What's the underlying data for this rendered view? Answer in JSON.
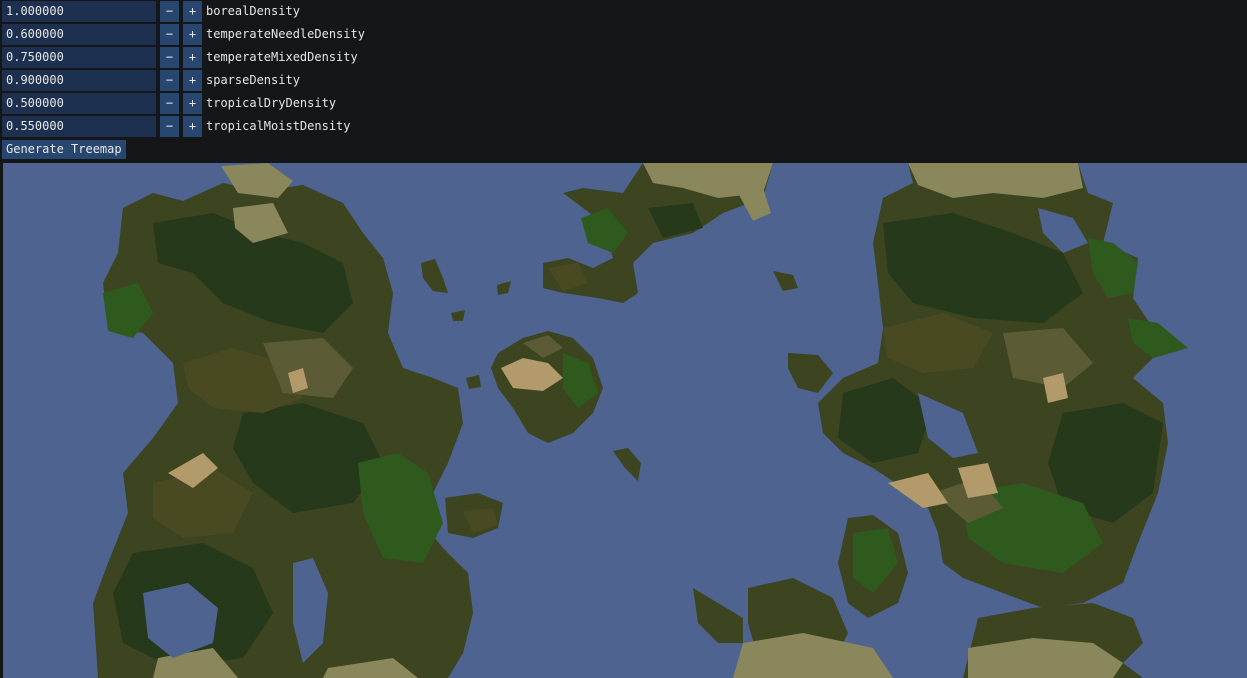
{
  "params": [
    {
      "value": "1.000000",
      "label": "borealDensity"
    },
    {
      "value": "0.600000",
      "label": "temperateNeedleDensity"
    },
    {
      "value": "0.750000",
      "label": "temperateMixedDensity"
    },
    {
      "value": "0.900000",
      "label": "sparseDensity"
    },
    {
      "value": "0.500000",
      "label": "tropicalDryDensity"
    },
    {
      "value": "0.550000",
      "label": "tropicalMoistDensity"
    }
  ],
  "buttons": {
    "minus": "−",
    "plus": "+",
    "generate": "Generate Treemap"
  },
  "colors": {
    "ocean": "#4e6390",
    "sand": "#b39a6a",
    "grass_pale": "#8a875d",
    "grass": "#5b5c35",
    "forest_mixed": "#3c4520",
    "forest_dark": "#26391a",
    "forest_green": "#2f5a1e",
    "forest_olive": "#494a22"
  }
}
